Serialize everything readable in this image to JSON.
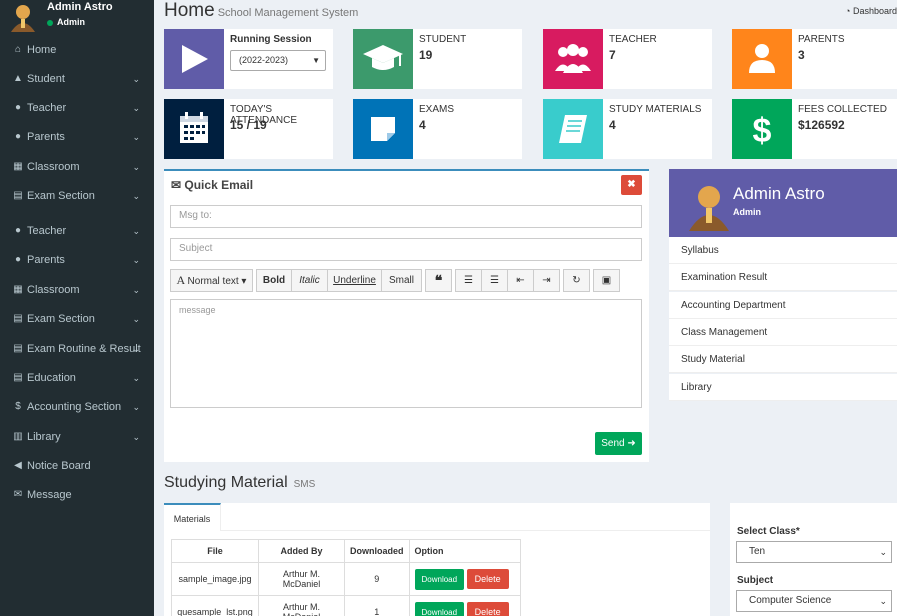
{
  "user": {
    "name": "Admin Astro",
    "status": "Admin"
  },
  "sidebar": {
    "items": [
      {
        "icon": "home-icon",
        "glyph": "⌂",
        "label": "Home",
        "chev": ""
      },
      {
        "icon": "graduation-cap-icon",
        "glyph": "▲",
        "label": "Student",
        "chev": "⌄"
      },
      {
        "icon": "users-icon",
        "glyph": "●",
        "label": "Teacher",
        "chev": "⌄"
      },
      {
        "icon": "user-icon",
        "glyph": "●",
        "label": "Parents",
        "chev": "⌄"
      },
      {
        "icon": "grid-icon",
        "glyph": "▦",
        "label": "Classroom",
        "chev": "⌄"
      },
      {
        "icon": "book-icon",
        "glyph": "▤",
        "label": "Exam Section",
        "chev": "⌄"
      },
      {
        "icon": "users-icon",
        "glyph": "●",
        "label": "Teacher",
        "chev": "⌄"
      },
      {
        "icon": "user-icon",
        "glyph": "●",
        "label": "Parents",
        "chev": "⌄"
      },
      {
        "icon": "grid-icon",
        "glyph": "▦",
        "label": "Classroom",
        "chev": "⌄"
      },
      {
        "icon": "book-icon",
        "glyph": "▤",
        "label": "Exam Section",
        "chev": "⌄"
      },
      {
        "icon": "file-icon",
        "glyph": "▤",
        "label": "Exam Routine & Result",
        "chev": "⌄"
      },
      {
        "icon": "book-icon",
        "glyph": "▤",
        "label": "Education",
        "chev": "⌄"
      },
      {
        "icon": "dollar-icon",
        "glyph": "$",
        "label": "Accounting Section",
        "chev": "⌄"
      },
      {
        "icon": "library-icon",
        "glyph": "▥",
        "label": "Library",
        "chev": "⌄"
      },
      {
        "icon": "bullhorn-icon",
        "glyph": "◀",
        "label": "Notice Board",
        "chev": ""
      },
      {
        "icon": "envelope-icon",
        "glyph": "✉",
        "label": "Message",
        "chev": ""
      }
    ]
  },
  "header": {
    "title": "Home",
    "subtitle": "School Management System",
    "dashboard": "Dashboard"
  },
  "boxes": [
    {
      "label": "Running Session",
      "select": "(2022-2023)",
      "color": "#605ca8",
      "icon": "play-icon"
    },
    {
      "label": "STUDENT",
      "value": "19",
      "color": "#3c9a6c",
      "icon": "graduation-cap-icon"
    },
    {
      "label": "TEACHER",
      "value": "7",
      "color": "#d81b60",
      "icon": "users-icon"
    },
    {
      "label": "PARENTS",
      "value": "3",
      "color": "#ff851b",
      "icon": "user-icon"
    },
    {
      "label": "TODAY'S ATTENDANCE",
      "value": "15 / 19",
      "color": "#001f3f",
      "icon": "calendar-icon"
    },
    {
      "label": "EXAMS",
      "value": "4",
      "color": "#0073b7",
      "icon": "note-icon"
    },
    {
      "label": "STUDY MATERIALS",
      "value": "4",
      "color": "#39cccc",
      "icon": "book-icon"
    },
    {
      "label": "FEES COLLECTED",
      "value": "$126592",
      "color": "#00a65a",
      "icon": "dollar-icon"
    }
  ],
  "email": {
    "title": "Quick Email",
    "to_placeholder": "Msg to:",
    "subject_placeholder": "Subject",
    "message_placeholder": "message",
    "send": "Send",
    "toolbar": {
      "normal": "Normal text",
      "bold": "Bold",
      "italic": "Italic",
      "underline": "Underline",
      "small": "Small"
    }
  },
  "profile": {
    "name": "Admin Astro",
    "role": "Admin",
    "links": [
      "Syllabus",
      "Examination Result",
      "Accounting Department",
      "Class Management",
      "Study Material",
      "Library"
    ]
  },
  "studying": {
    "title": "Studying Material",
    "subtitle": "SMS",
    "tab": "Materials",
    "headers": [
      "File",
      "Added By",
      "Downloaded",
      "Option"
    ],
    "rows": [
      {
        "file": "sample_image.jpg",
        "added_by": "Arthur M. McDaniel",
        "downloaded": "9"
      },
      {
        "file": "quesample_lst.png",
        "added_by": "Arthur M. McDaniel",
        "downloaded": "1"
      }
    ],
    "download": "Download",
    "delete": "Delete"
  },
  "filter": {
    "class_label": "Select Class*",
    "class_value": "Ten",
    "subject_label": "Subject",
    "subject_value": "Computer Science"
  }
}
